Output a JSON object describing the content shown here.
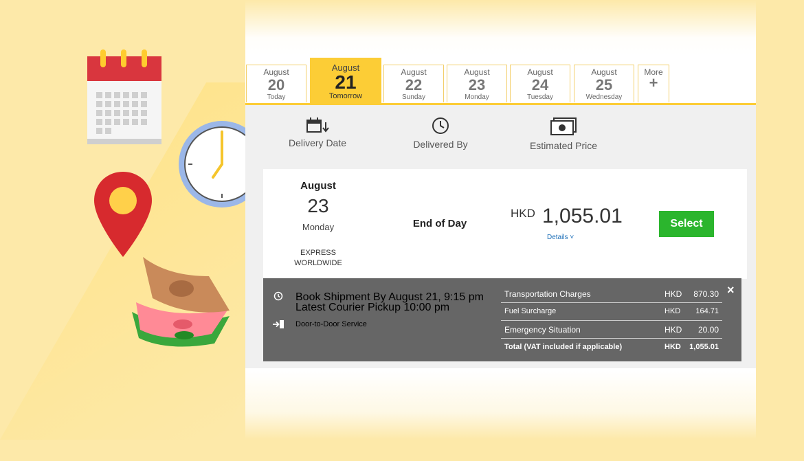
{
  "tabs": [
    {
      "month": "August",
      "day": "20",
      "weekday": "Today",
      "active": false
    },
    {
      "month": "August",
      "day": "21",
      "weekday": "Tomorrow",
      "active": true
    },
    {
      "month": "August",
      "day": "22",
      "weekday": "Sunday",
      "active": false
    },
    {
      "month": "August",
      "day": "23",
      "weekday": "Monday",
      "active": false
    },
    {
      "month": "August",
      "day": "24",
      "weekday": "Tuesday",
      "active": false
    },
    {
      "month": "August",
      "day": "25",
      "weekday": "Wednesday",
      "active": false
    }
  ],
  "more_tab": {
    "label": "More",
    "icon": "plus-icon",
    "symbol": "+"
  },
  "headers": {
    "delivery_date": "Delivery Date",
    "delivered_by": "Delivered By",
    "estimated_price": "Estimated Price"
  },
  "result": {
    "month": "August",
    "day": "23",
    "weekday": "Monday",
    "service_line1": "EXPRESS",
    "service_line2": "WORLDWIDE",
    "delivered_by": "End of Day",
    "currency": "HKD",
    "amount": "1,055.01",
    "details_label": "Details ˅",
    "select_label": "Select"
  },
  "details_panel": {
    "book_by": "Book Shipment By August 21, 9:15 pm",
    "pickup": "Latest Courier Pickup 10:00 pm",
    "door": "Door-to-Door Service",
    "close": "×",
    "rates": [
      {
        "label": "Transportation Charges",
        "currency": "HKD",
        "value": "870.30"
      },
      {
        "label": "Fuel Surcharge",
        "currency": "HKD",
        "value": "164.71"
      },
      {
        "label": "Emergency Situation",
        "currency": "HKD",
        "value": "20.00"
      },
      {
        "label": "Total (VAT included if applicable)",
        "currency": "HKD",
        "value": "1,055.01"
      }
    ]
  },
  "colors": {
    "accent": "#fccd36",
    "select": "#2bb52d",
    "panel": "#666666",
    "link": "#1d6fb8"
  }
}
